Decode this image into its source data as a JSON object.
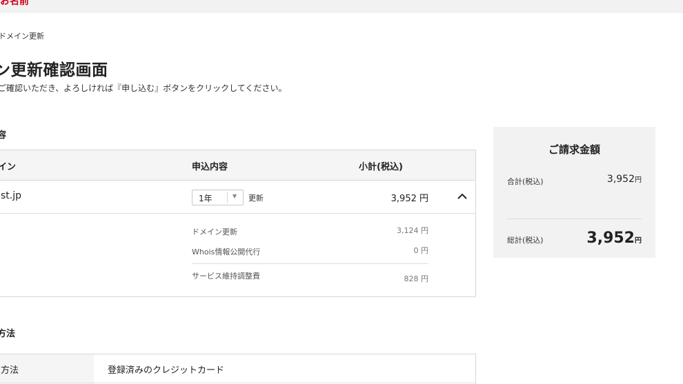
{
  "header": {
    "logo_text": "お名前"
  },
  "breadcrumb": "ドメイン更新",
  "page": {
    "title": "ン更新確認画面",
    "lead": "ご確認いただき、よろしければ『申し込む』ボタンをクリックしてください。"
  },
  "order_section": {
    "heading": "容",
    "columns": {
      "domain": "イン",
      "content": "申込内容",
      "subtotal": "小計(税込)"
    },
    "row": {
      "domain": "st.jp",
      "term_value": "1年",
      "action": "更新",
      "price": "3,952 円"
    },
    "details": [
      {
        "label": "ドメイン更新",
        "price": "3,124 円"
      },
      {
        "label": "Whois情報公開代行",
        "price": "0 円"
      },
      {
        "label": "サービス維持調整費",
        "price": "828 円"
      }
    ]
  },
  "summary": {
    "title": "ご請求金額",
    "subtotal_label": "合計(税込)",
    "subtotal_value": "3,952",
    "total_label": "総計(税込)",
    "total_value": "3,952",
    "currency": "円"
  },
  "payment_section": {
    "heading": "方法",
    "row_label": "方法",
    "row_value": "登録済みのクレジットカード"
  },
  "colors": {
    "brand": "#d0021b",
    "header_bg": "#f2f2f2",
    "summary_bg": "#f2f2f2"
  },
  "icons": {
    "collapse": "chevron-up-icon",
    "select_arrow": "dropdown-arrow-icon"
  }
}
